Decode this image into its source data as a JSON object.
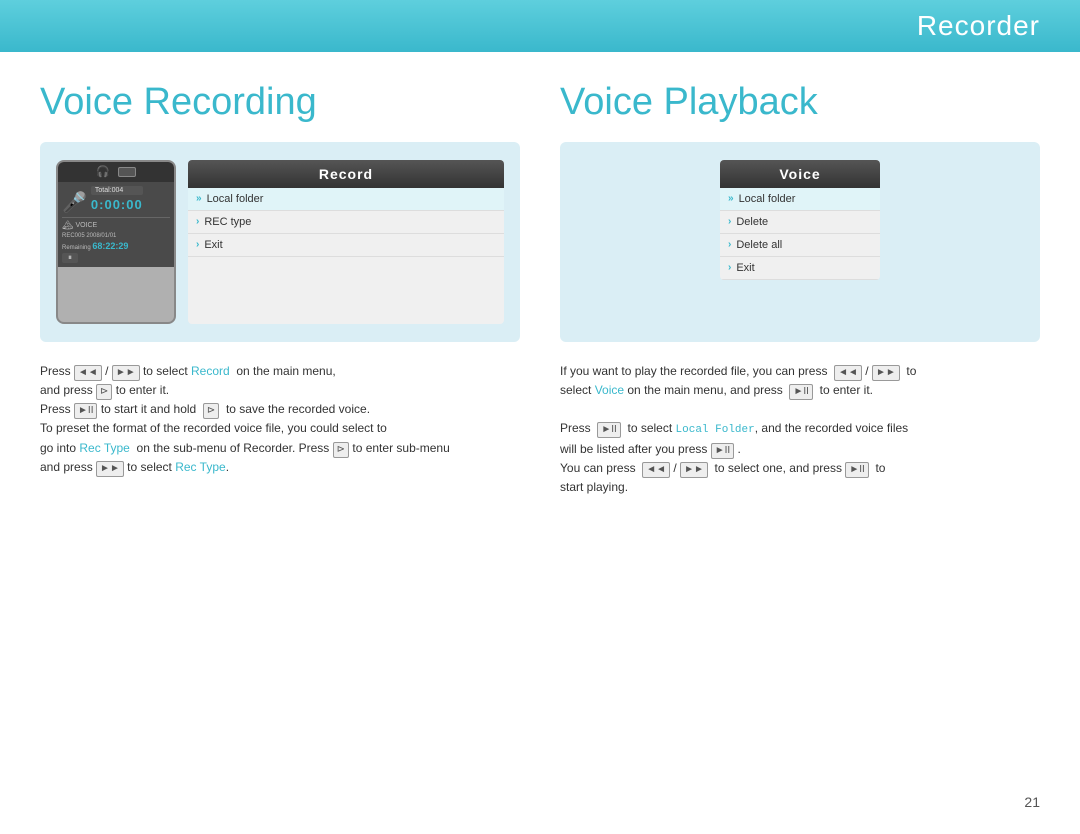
{
  "page": {
    "background": "#ffffff",
    "page_number": "21"
  },
  "header": {
    "title": "Recorder",
    "bg_color": "#3ab8cc"
  },
  "left_section": {
    "title": "Voice Recording",
    "phone": {
      "total_label": "Total:004",
      "time_display": "0:00:00",
      "voice_label": "VOICE",
      "rec_info": "REC005  2008/01/01",
      "remaining_label": "Remaining",
      "remaining_time": "68:22:29"
    },
    "record_menu": {
      "header": "Record",
      "items": [
        {
          "label": "Local folder",
          "active": true
        },
        {
          "label": "REC type",
          "active": false
        },
        {
          "label": "Exit",
          "active": false
        }
      ]
    },
    "description": [
      "Press  ◄◄ / ►► to select Record  on the main menu,",
      "and press  ⊳  to enter it.",
      "Press ►II  to start it and hold  ⊳  to save the recorded voice.",
      "To preset the format of the recorded voice file, you could select to",
      "go into Rec Type  on the sub-menu of Recorder. Press ⊳ to enter sub-menu",
      "and press ►► to select Rec Type."
    ]
  },
  "right_section": {
    "title": "Voice Playback",
    "voice_menu": {
      "header": "Voice",
      "items": [
        {
          "label": "Local folder",
          "active": true
        },
        {
          "label": "Delete",
          "active": false
        },
        {
          "label": "Delete all",
          "active": false
        },
        {
          "label": "Exit",
          "active": false
        }
      ]
    },
    "description": [
      "If you want to play the recorded file, you can press  ◄◄ / ►► to",
      "select Voice on the main menu, and press  ►II  to enter it.",
      "",
      "Press  ►II  to select Local Folder, and the recorded voice files",
      "will be listed after you press ►II .",
      "You can press  ◄◄ / ►►  to select one, and press ►II  to",
      "start playing."
    ]
  }
}
